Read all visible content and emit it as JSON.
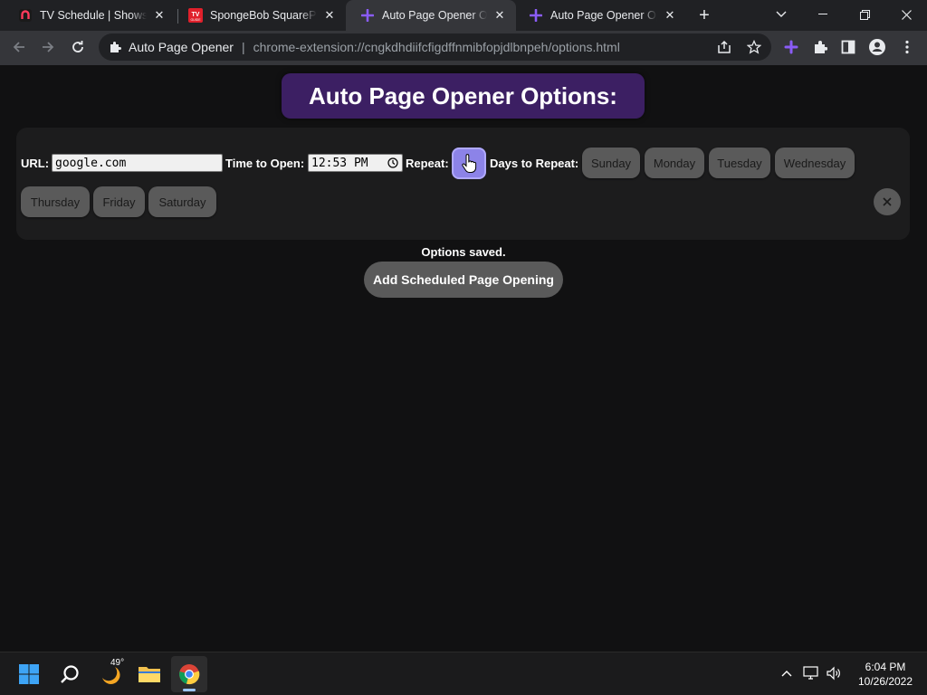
{
  "browser": {
    "tabs": [
      {
        "title": "TV Schedule | Shows | Movies",
        "favicon": "peacock-icon"
      },
      {
        "title": "SpongeBob SquarePants",
        "favicon": "tv-guide-icon"
      },
      {
        "title": "Auto Page Opener Options",
        "favicon": "plus-icon",
        "active": true
      },
      {
        "title": "Auto Page Opener Options",
        "favicon": "plus-icon"
      }
    ],
    "omnibox": {
      "site_label": "Auto Page Opener",
      "url": "chrome-extension://cngkdhdiifcfigdffnmibfopjdlbnpeh/options.html"
    },
    "accent_color": "#8a5cf6"
  },
  "page": {
    "heading": "Auto Page Opener Options:",
    "entry": {
      "url_label": "URL:",
      "url_value": "google.com",
      "time_label": "Time to Open:",
      "time_value": "12:53 PM",
      "repeat_label": "Repeat:",
      "days_label": "Days to Repeat:",
      "days": [
        "Sunday",
        "Monday",
        "Tuesday",
        "Wednesday",
        "Thursday",
        "Friday",
        "Saturday"
      ]
    },
    "status": "Options saved.",
    "add_button": "Add Scheduled Page Opening"
  },
  "taskbar": {
    "weather_temp": "49°",
    "time": "6:04 PM",
    "date": "10/26/2022"
  }
}
